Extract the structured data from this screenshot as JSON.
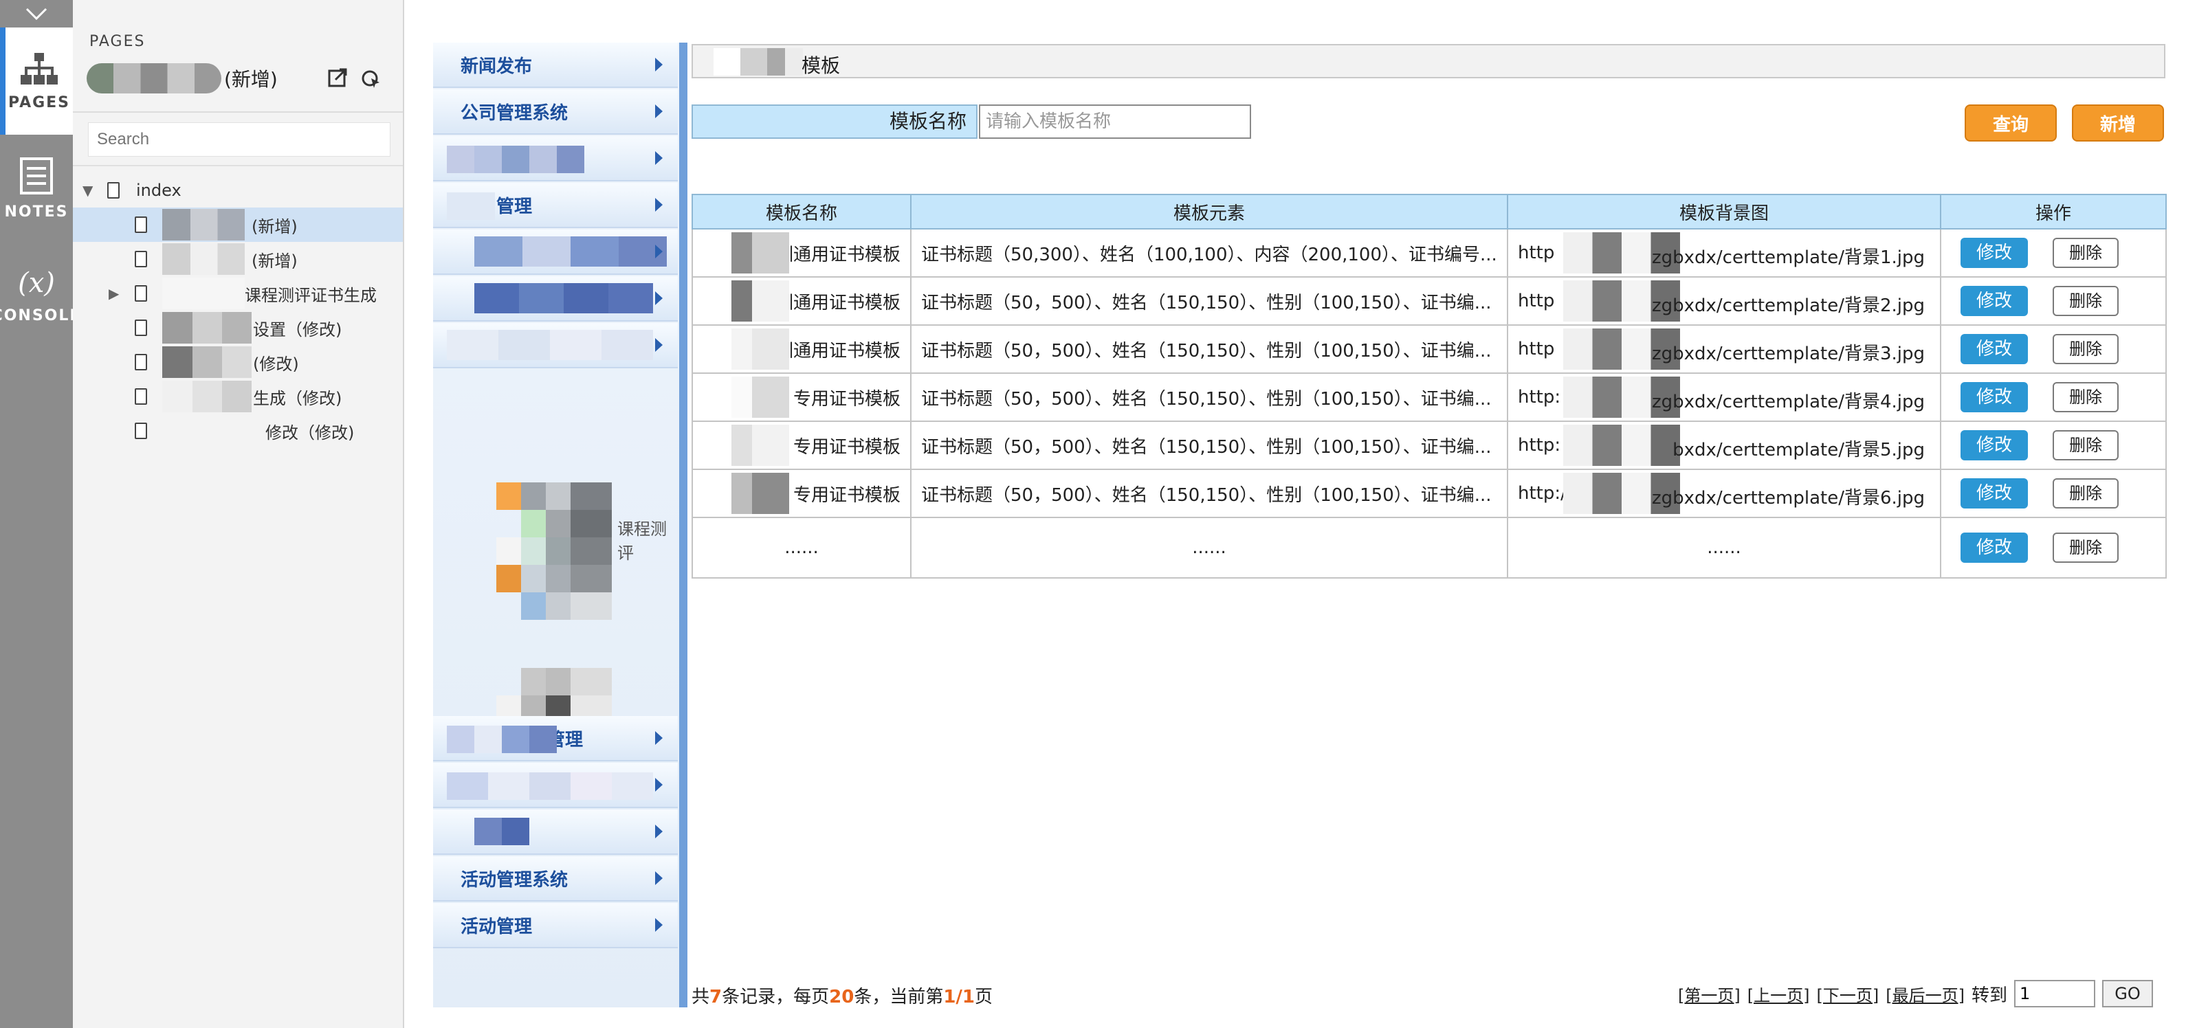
{
  "rail": {
    "tabs": [
      {
        "label": "PAGES",
        "icon": "sitemap-icon",
        "active": true
      },
      {
        "label": "NOTES",
        "icon": "notes-icon",
        "active": false
      },
      {
        "label": "CONSOLE",
        "icon": "function-icon",
        "active": false
      }
    ],
    "console_symbol": "(x)"
  },
  "pages_panel": {
    "header": "PAGES",
    "current_page_suffix": "(新增)",
    "search_placeholder": "Search",
    "tree": [
      {
        "label": "index",
        "level": 0
      },
      {
        "label": "(新增)",
        "level": 1,
        "selected": true
      },
      {
        "label": "(新增)",
        "level": 1
      },
      {
        "label": "课程测评证书生成",
        "level": 1,
        "has_children": true
      },
      {
        "label": "设置（修改)",
        "level": 1
      },
      {
        "label": "(修改)",
        "level": 1
      },
      {
        "label": "生成（修改)",
        "level": 1
      },
      {
        "label": "修改（修改)",
        "level": 1
      }
    ]
  },
  "left_nav": {
    "items": [
      {
        "label": "新闻发布"
      },
      {
        "label": "公司管理系统"
      },
      {
        "label": ""
      },
      {
        "label": "管理"
      },
      {
        "label": ""
      },
      {
        "label": ""
      },
      {
        "label": ""
      },
      {
        "label": "课程测评"
      },
      {
        "label": "管理"
      },
      {
        "label": ""
      },
      {
        "label": ""
      },
      {
        "label": "活动管理系统"
      },
      {
        "label": "活动管理"
      }
    ]
  },
  "main": {
    "title": "模板",
    "filter_label": "模板名称",
    "filter_placeholder": "请输入模板名称",
    "search_button": "查询",
    "add_button": "新增",
    "table": {
      "columns": [
        "模板名称",
        "模板元素",
        "模板背景图",
        "操作"
      ],
      "rows": [
        {
          "name": "训通用证书模板",
          "elements": "证书标题（50,300）、姓名（100,100）、内容（200,100）、证书编号...",
          "bg": "http",
          "bg_tail": "zgbxdx/certtemplate/背景1.jpg"
        },
        {
          "name": "训通用证书模板",
          "elements": "证书标题（50，500）、姓名（150,150）、性别（100,150）、证书编...",
          "bg": "http",
          "bg_tail": "zgbxdx/certtemplate/背景2.jpg"
        },
        {
          "name": "训通用证书模板",
          "elements": "证书标题（50，500）、姓名（150,150）、性别（100,150）、证书编...",
          "bg": "http",
          "bg_tail": "zgbxdx/certtemplate/背景3.jpg"
        },
        {
          "name": "专用证书模板",
          "elements": "证书标题（50，500）、姓名（150,150）、性别（100,150）、证书编...",
          "bg": "http:",
          "bg_tail": "zgbxdx/certtemplate/背景4.jpg"
        },
        {
          "name": "专用证书模板",
          "elements": "证书标题（50，500）、姓名（150,150）、性别（100,150）、证书编...",
          "bg": "http:",
          "bg_tail": "bxdx/certtemplate/背景5.jpg"
        },
        {
          "name": "专用证书模板",
          "elements": "证书标题（50，500）、姓名（150,150）、性别（100,150）、证书编...",
          "bg": "http://",
          "bg_tail": "zgbxdx/certtemplate/背景6.jpg"
        }
      ],
      "ellipsis": "......",
      "edit_label": "修改",
      "delete_label": "删除"
    },
    "footer": {
      "prefix": "共",
      "total": "7",
      "mid1": "条记录，每页",
      "per_page": "20",
      "mid2": "条，当前第",
      "page": "1/1",
      "suffix": "页",
      "first": "[第一页]",
      "prev": "[上一页]",
      "next": "[下一页]",
      "last": "[最后一页]",
      "goto_label": "转到",
      "goto_value": "1",
      "go": "GO"
    }
  },
  "colors": {
    "rail": "#8c8c8c",
    "accent_blue": "#2f7fd6",
    "header_cell": "#c5e6fb",
    "orange": "#f49a2a",
    "edit_blue": "#2b97d4",
    "highlight": "#e8651b"
  }
}
